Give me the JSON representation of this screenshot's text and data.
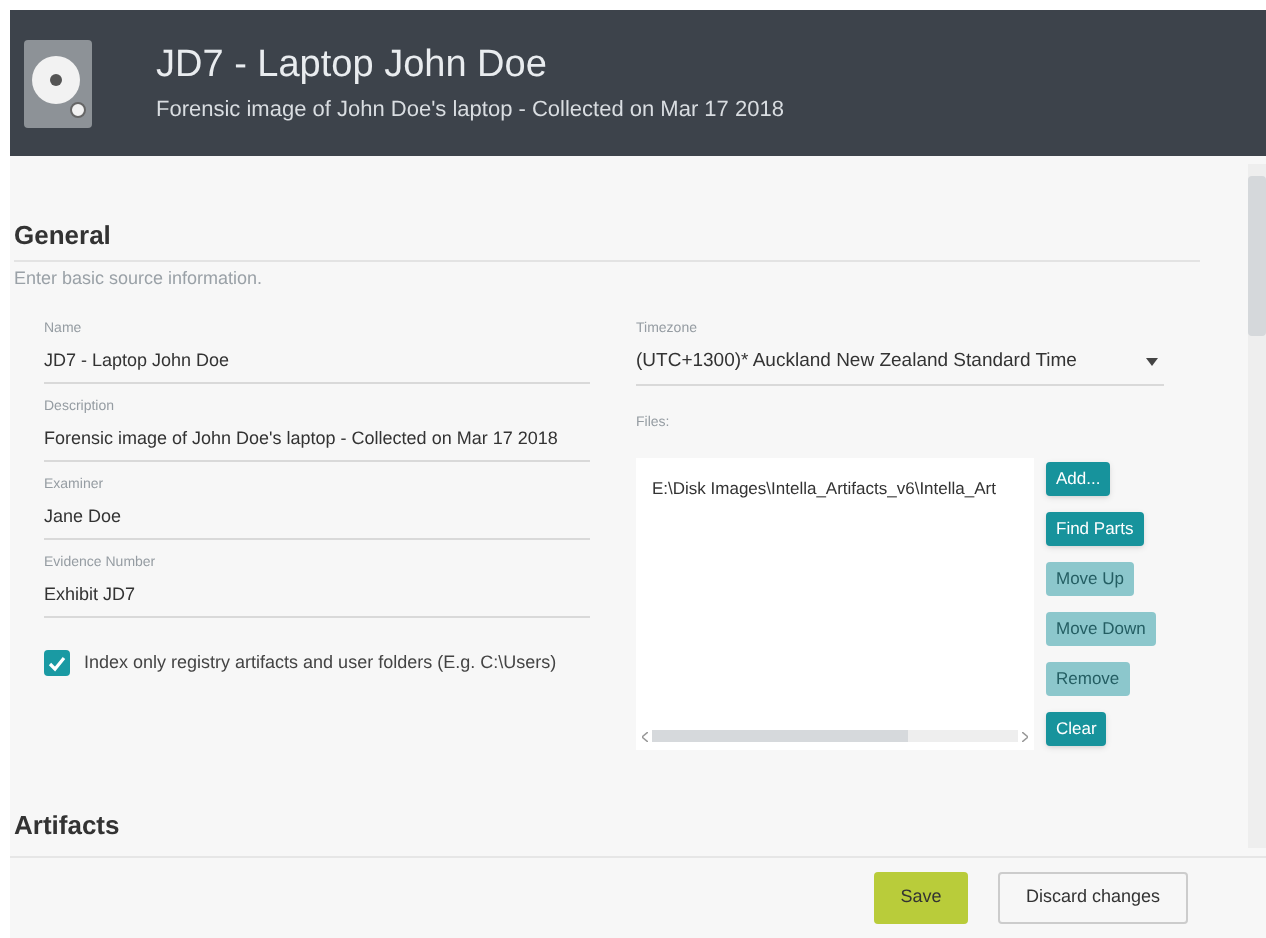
{
  "header": {
    "title": "JD7 - Laptop John Doe",
    "subtitle": "Forensic image of John Doe's laptop - Collected on Mar 17 2018"
  },
  "general": {
    "heading": "General",
    "hint": "Enter basic source information.",
    "fields": [
      {
        "label": "Name",
        "value": "JD7 - Laptop John Doe"
      },
      {
        "label": "Description",
        "value": "Forensic image of John Doe's laptop - Collected on Mar 17 2018"
      },
      {
        "label": "Examiner",
        "value": "Jane Doe"
      },
      {
        "label": "Evidence Number",
        "value": "Exhibit JD7"
      }
    ],
    "checkbox": {
      "label": "Index only registry artifacts and user folders (E.g. C:\\Users)",
      "checked": true
    },
    "timezone": {
      "label": "Timezone",
      "value": "(UTC+1300)* Auckland New Zealand Standard Time"
    },
    "files": {
      "label": "Files:",
      "items": [
        "E:\\Disk Images\\Intella_Artifacts_v6\\Intella_Art"
      ],
      "buttons": [
        {
          "label": "Add...",
          "disabled": false
        },
        {
          "label": "Find Parts",
          "disabled": false
        },
        {
          "label": "Move Up",
          "disabled": true
        },
        {
          "label": "Move Down",
          "disabled": true
        },
        {
          "label": "Remove",
          "disabled": true
        },
        {
          "label": "Clear",
          "disabled": false
        }
      ]
    }
  },
  "artifacts": {
    "heading": "Artifacts"
  },
  "footer": {
    "buttons": [
      {
        "label": "Save",
        "kind": "primary"
      },
      {
        "label": "Discard changes",
        "kind": "secondary"
      }
    ]
  }
}
